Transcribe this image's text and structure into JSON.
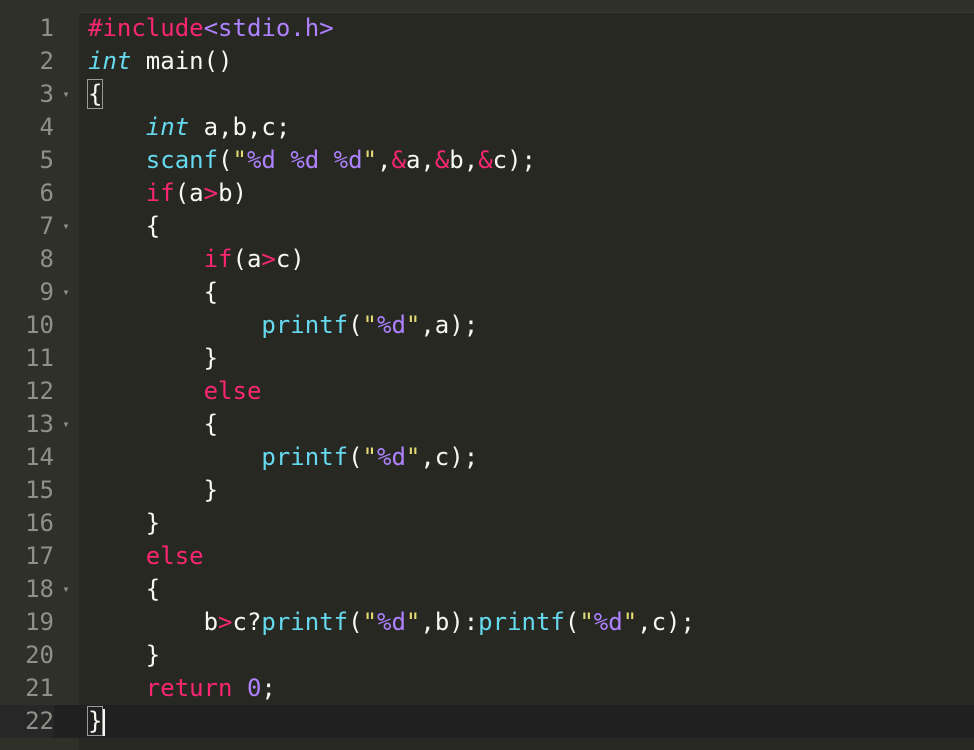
{
  "colors": {
    "keyword": "#f92672",
    "type": "#66d9ef",
    "function": "#66d9ef",
    "string": "#e6db74",
    "format": "#ae81ff",
    "number": "#ae81ff",
    "plain": "#f8f8f2",
    "gutter_text": "#8f908a"
  },
  "editor": {
    "lines": [
      {
        "n": "1",
        "fold": false,
        "tokens": [
          {
            "t": "#include",
            "c": "keyword"
          },
          {
            "t": "<stdio.h>",
            "c": "format"
          }
        ]
      },
      {
        "n": "2",
        "fold": false,
        "tokens": [
          {
            "t": "int",
            "c": "type",
            "i": true
          },
          {
            "t": " main()",
            "c": "plain"
          }
        ]
      },
      {
        "n": "3",
        "fold": true,
        "tokens": [
          {
            "t": "{",
            "c": "plain",
            "mark": true
          }
        ]
      },
      {
        "n": "4",
        "fold": false,
        "tokens": [
          {
            "t": "    ",
            "c": "plain"
          },
          {
            "t": "int",
            "c": "type",
            "i": true
          },
          {
            "t": " a,b,c;",
            "c": "plain"
          }
        ]
      },
      {
        "n": "5",
        "fold": false,
        "tokens": [
          {
            "t": "    ",
            "c": "plain"
          },
          {
            "t": "scanf",
            "c": "function"
          },
          {
            "t": "(",
            "c": "plain"
          },
          {
            "t": "\"",
            "c": "string"
          },
          {
            "t": "%d",
            "c": "format"
          },
          {
            "t": " ",
            "c": "string"
          },
          {
            "t": "%d",
            "c": "format"
          },
          {
            "t": " ",
            "c": "string"
          },
          {
            "t": "%d",
            "c": "format"
          },
          {
            "t": "\"",
            "c": "string"
          },
          {
            "t": ",",
            "c": "plain"
          },
          {
            "t": "&",
            "c": "keyword"
          },
          {
            "t": "a,",
            "c": "plain"
          },
          {
            "t": "&",
            "c": "keyword"
          },
          {
            "t": "b,",
            "c": "plain"
          },
          {
            "t": "&",
            "c": "keyword"
          },
          {
            "t": "c);",
            "c": "plain"
          }
        ]
      },
      {
        "n": "6",
        "fold": false,
        "tokens": [
          {
            "t": "    ",
            "c": "plain"
          },
          {
            "t": "if",
            "c": "keyword"
          },
          {
            "t": "(a",
            "c": "plain"
          },
          {
            "t": ">",
            "c": "keyword"
          },
          {
            "t": "b)",
            "c": "plain"
          }
        ]
      },
      {
        "n": "7",
        "fold": true,
        "tokens": [
          {
            "t": "    {",
            "c": "plain"
          }
        ]
      },
      {
        "n": "8",
        "fold": false,
        "tokens": [
          {
            "t": "        ",
            "c": "plain"
          },
          {
            "t": "if",
            "c": "keyword"
          },
          {
            "t": "(a",
            "c": "plain"
          },
          {
            "t": ">",
            "c": "keyword"
          },
          {
            "t": "c)",
            "c": "plain"
          }
        ]
      },
      {
        "n": "9",
        "fold": true,
        "tokens": [
          {
            "t": "        {",
            "c": "plain"
          }
        ]
      },
      {
        "n": "10",
        "fold": false,
        "tokens": [
          {
            "t": "            ",
            "c": "plain"
          },
          {
            "t": "printf",
            "c": "function"
          },
          {
            "t": "(",
            "c": "plain"
          },
          {
            "t": "\"",
            "c": "string"
          },
          {
            "t": "%d",
            "c": "format"
          },
          {
            "t": "\"",
            "c": "string"
          },
          {
            "t": ",a);",
            "c": "plain"
          }
        ]
      },
      {
        "n": "11",
        "fold": false,
        "tokens": [
          {
            "t": "        }",
            "c": "plain"
          }
        ]
      },
      {
        "n": "12",
        "fold": false,
        "tokens": [
          {
            "t": "        ",
            "c": "plain"
          },
          {
            "t": "else",
            "c": "keyword"
          }
        ]
      },
      {
        "n": "13",
        "fold": true,
        "tokens": [
          {
            "t": "        {",
            "c": "plain"
          }
        ]
      },
      {
        "n": "14",
        "fold": false,
        "tokens": [
          {
            "t": "            ",
            "c": "plain"
          },
          {
            "t": "printf",
            "c": "function"
          },
          {
            "t": "(",
            "c": "plain"
          },
          {
            "t": "\"",
            "c": "string"
          },
          {
            "t": "%d",
            "c": "format"
          },
          {
            "t": "\"",
            "c": "string"
          },
          {
            "t": ",c);",
            "c": "plain"
          }
        ]
      },
      {
        "n": "15",
        "fold": false,
        "tokens": [
          {
            "t": "        }",
            "c": "plain"
          }
        ]
      },
      {
        "n": "16",
        "fold": false,
        "tokens": [
          {
            "t": "    }",
            "c": "plain"
          }
        ]
      },
      {
        "n": "17",
        "fold": false,
        "tokens": [
          {
            "t": "    ",
            "c": "plain"
          },
          {
            "t": "else",
            "c": "keyword"
          }
        ]
      },
      {
        "n": "18",
        "fold": true,
        "tokens": [
          {
            "t": "    {",
            "c": "plain"
          }
        ]
      },
      {
        "n": "19",
        "fold": false,
        "tokens": [
          {
            "t": "        b",
            "c": "plain"
          },
          {
            "t": ">",
            "c": "keyword"
          },
          {
            "t": "c?",
            "c": "plain"
          },
          {
            "t": "printf",
            "c": "function"
          },
          {
            "t": "(",
            "c": "plain"
          },
          {
            "t": "\"",
            "c": "string"
          },
          {
            "t": "%d",
            "c": "format"
          },
          {
            "t": "\"",
            "c": "string"
          },
          {
            "t": ",b):",
            "c": "plain"
          },
          {
            "t": "printf",
            "c": "function"
          },
          {
            "t": "(",
            "c": "plain"
          },
          {
            "t": "\"",
            "c": "string"
          },
          {
            "t": "%d",
            "c": "format"
          },
          {
            "t": "\"",
            "c": "string"
          },
          {
            "t": ",c);",
            "c": "plain"
          }
        ]
      },
      {
        "n": "20",
        "fold": false,
        "tokens": [
          {
            "t": "    }",
            "c": "plain"
          }
        ]
      },
      {
        "n": "21",
        "fold": false,
        "tokens": [
          {
            "t": "    ",
            "c": "plain"
          },
          {
            "t": "return",
            "c": "keyword"
          },
          {
            "t": " ",
            "c": "plain"
          },
          {
            "t": "0",
            "c": "number"
          },
          {
            "t": ";",
            "c": "plain"
          }
        ]
      },
      {
        "n": "22",
        "fold": false,
        "active": true,
        "cursor": true,
        "tokens": [
          {
            "t": "}",
            "c": "plain",
            "mark": true
          }
        ]
      }
    ],
    "fold_icon": "fold-arrow-icon"
  }
}
